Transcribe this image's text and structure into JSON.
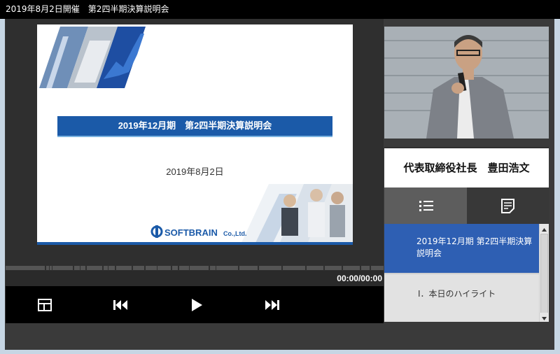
{
  "window": {
    "title": "2019年8月2日開催　第2四半期決算説明会"
  },
  "slide": {
    "title": "2019年12月期　第2四半期決算説明会",
    "date": "2019年8月2日",
    "logo_text": "SOFTBRAIN",
    "logo_suffix": "Co.,Ltd."
  },
  "player": {
    "time": "00:00/00:00",
    "progress_fraction": 0,
    "controls": [
      "layout-icon",
      "previous-track-icon",
      "play-icon",
      "next-track-icon"
    ]
  },
  "speaker": {
    "name": "代表取締役社長　豊田浩文"
  },
  "tabs": {
    "icons": [
      "list-icon",
      "notes-icon"
    ]
  },
  "chapters": [
    {
      "label": "2019年12月期 第2四半期決算説明会"
    },
    {
      "label": "Ⅰ．本日のハイライト"
    }
  ],
  "colors": {
    "accent": "#2e5fb3",
    "slide_bar": "#1b5aa8"
  }
}
